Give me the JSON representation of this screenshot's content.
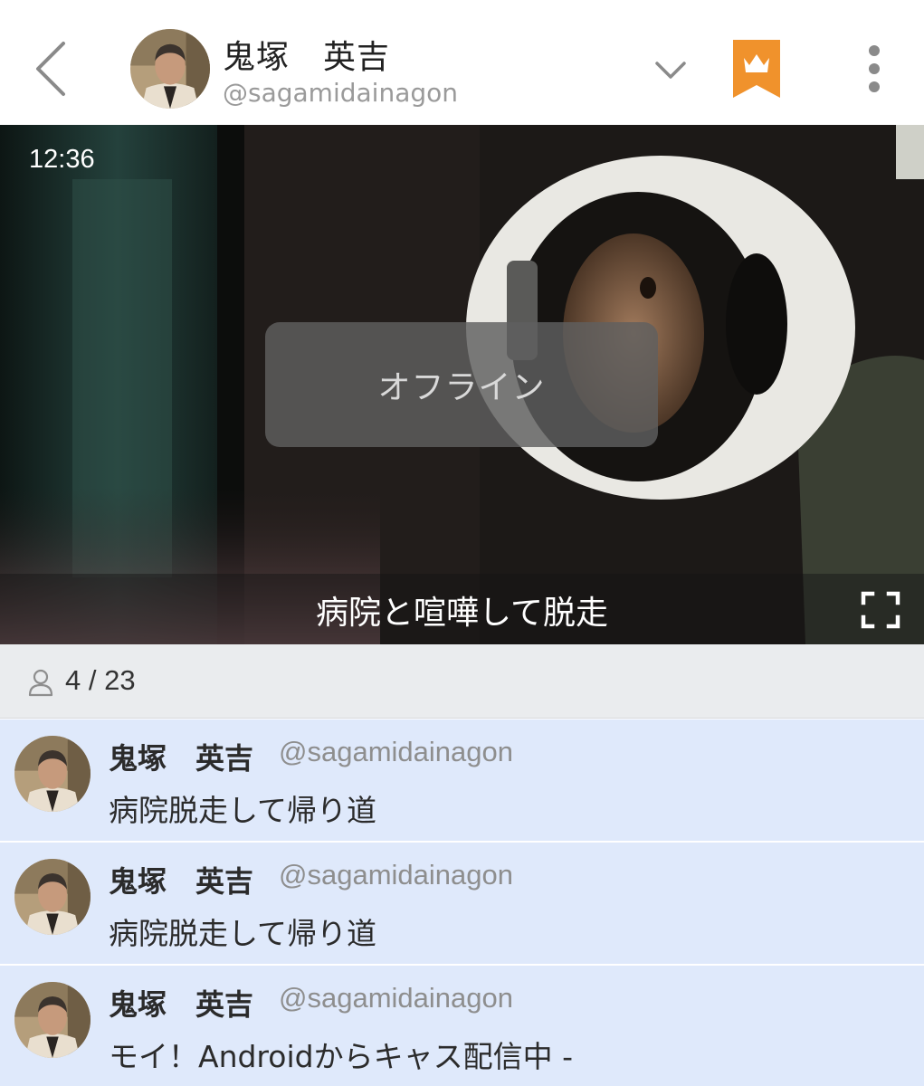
{
  "header": {
    "name": "鬼塚　英吉",
    "handle": "@sagamidainagon",
    "icons": {
      "back": "chevron-left-icon",
      "expand": "chevron-down-icon",
      "crown": "crown-bookmark-icon",
      "more": "more-vertical-icon"
    },
    "accent_color": "#f0922c"
  },
  "video": {
    "time": "12:36",
    "status": "オフライン",
    "caption": "病院と喧嘩して脱走",
    "fullscreen_icon": "fullscreen-icon"
  },
  "viewers": {
    "count": "4 / 23",
    "icon": "person-icon"
  },
  "comments": [
    {
      "name": "鬼塚　英吉",
      "handle": "@sagamidainagon",
      "text": "病院脱走して帰り道"
    },
    {
      "name": "鬼塚　英吉",
      "handle": "@sagamidainagon",
      "text": "病院脱走して帰り道"
    },
    {
      "name": "鬼塚　英吉",
      "handle": "@sagamidainagon",
      "text": "モイ！Androidからキャス配信中 -"
    }
  ],
  "colors": {
    "comment_bg": "#dfe9fb",
    "viewer_bar_bg": "#eaecee"
  }
}
